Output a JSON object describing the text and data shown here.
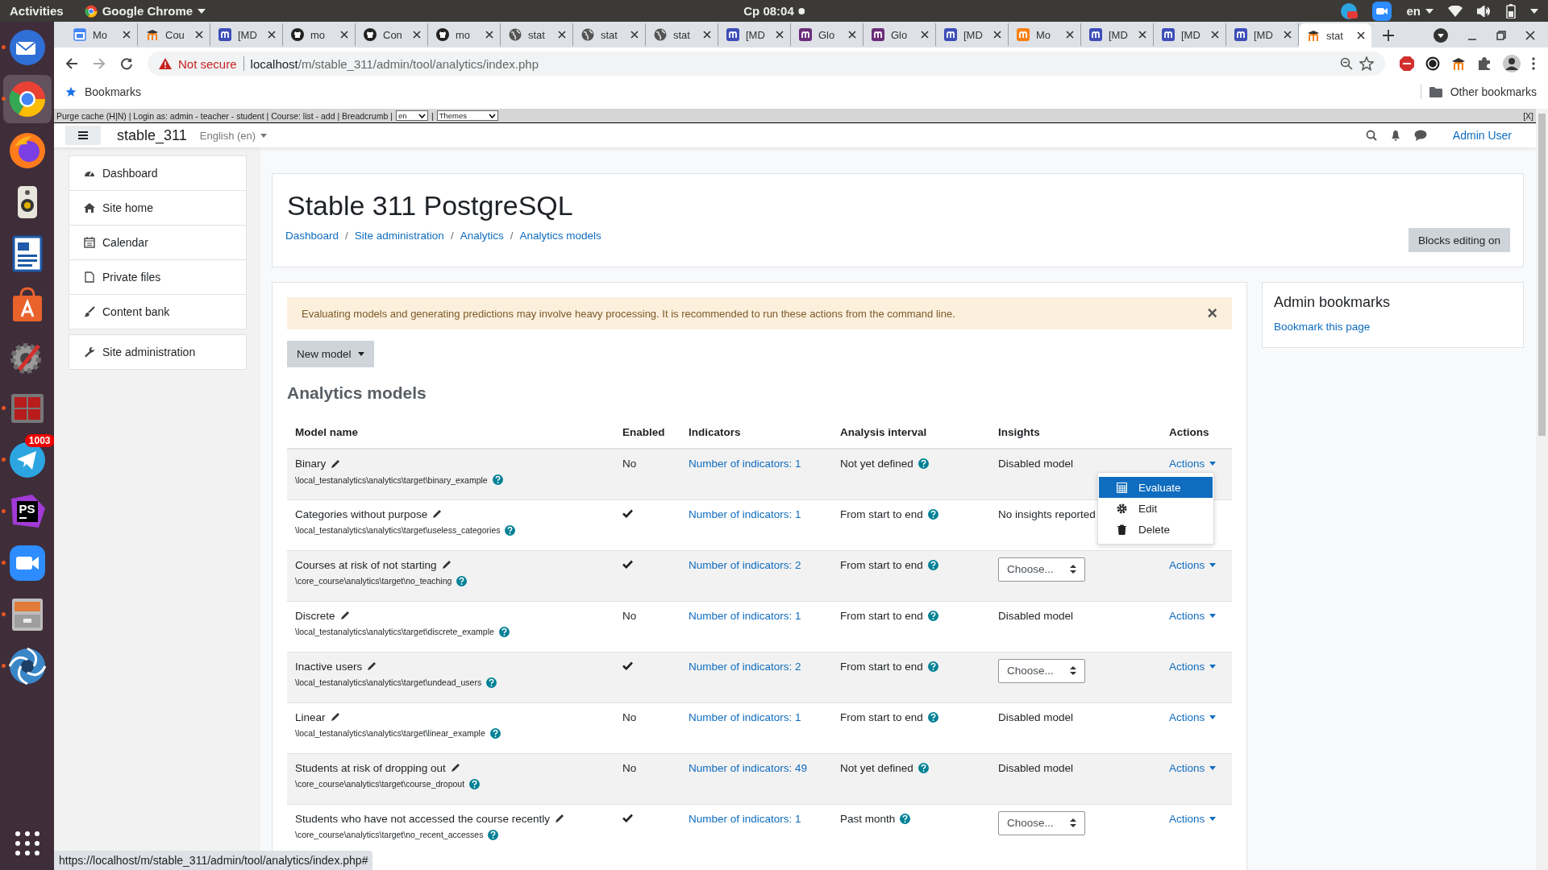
{
  "system_bar": {
    "activities": "Activities",
    "app": "Google Chrome",
    "clock": "Cp 08:04",
    "language": "en"
  },
  "dock": [
    {
      "kind": "mail",
      "running": true,
      "selected": false
    },
    {
      "kind": "chrome",
      "running": true,
      "selected": true
    },
    {
      "kind": "firefox",
      "running": false,
      "selected": false
    },
    {
      "kind": "speaker",
      "running": false,
      "selected": false
    },
    {
      "kind": "writer",
      "running": false,
      "selected": false
    },
    {
      "kind": "store",
      "running": false,
      "selected": false
    },
    {
      "kind": "settings",
      "running": false,
      "selected": false
    },
    {
      "kind": "terminal",
      "running": true,
      "selected": false
    },
    {
      "kind": "telegram",
      "running": true,
      "selected": false,
      "badge": "1003"
    },
    {
      "kind": "phpstorm",
      "running": true,
      "selected": false,
      "label": "PS"
    },
    {
      "kind": "zoom",
      "running": true,
      "selected": false
    },
    {
      "kind": "files",
      "running": true,
      "selected": false
    },
    {
      "kind": "shutter",
      "running": true,
      "selected": false
    }
  ],
  "tabs": [
    {
      "title": "Mo",
      "kind": "calendar",
      "selected": false
    },
    {
      "title": "Cou",
      "kind": "moodle",
      "selected": false
    },
    {
      "title": "[MD",
      "kind": "tracker",
      "selected": false
    },
    {
      "title": "mo",
      "kind": "github",
      "selected": false
    },
    {
      "title": "Con",
      "kind": "github",
      "selected": false
    },
    {
      "title": "mo",
      "kind": "github",
      "selected": false
    },
    {
      "title": "stat",
      "kind": "globe",
      "selected": false
    },
    {
      "title": "stat",
      "kind": "globe",
      "selected": false
    },
    {
      "title": "stat",
      "kind": "globe",
      "selected": false
    },
    {
      "title": "[MD",
      "kind": "tracker",
      "selected": false
    },
    {
      "title": "Glo",
      "kind": "glossary",
      "selected": false
    },
    {
      "title": "Glo",
      "kind": "glossary",
      "selected": false
    },
    {
      "title": "[MD",
      "kind": "tracker",
      "selected": false
    },
    {
      "title": "Mo",
      "kind": "orange",
      "selected": false
    },
    {
      "title": "[MD",
      "kind": "tracker",
      "selected": false
    },
    {
      "title": "[MD",
      "kind": "tracker",
      "selected": false
    },
    {
      "title": "[MD",
      "kind": "tracker",
      "selected": false
    },
    {
      "title": "stat",
      "kind": "moodle",
      "selected": true
    }
  ],
  "address": {
    "warning": "Not secure",
    "host": "localhost",
    "path": "/m/stable_311/admin/tool/analytics/index.php"
  },
  "bookmarks": {
    "label": "Bookmarks",
    "other": "Other bookmarks"
  },
  "dev_bar": {
    "text": "Purge cache (H|N) | Login as: admin - teacher - student | Course: list - add | Breadcrumb |",
    "language": "en",
    "separator": "|",
    "theme": "Themes",
    "close": "[X]"
  },
  "moodle_nav": {
    "site": "stable_311",
    "language": "English (en)",
    "user": "Admin User"
  },
  "sidebar": [
    [
      {
        "label": "Dashboard",
        "kind": "dashboard"
      },
      {
        "label": "Site home",
        "kind": "home"
      },
      {
        "label": "Calendar",
        "kind": "calendar"
      },
      {
        "label": "Private files",
        "kind": "file"
      },
      {
        "label": "Content bank",
        "kind": "brush"
      }
    ],
    [
      {
        "label": "Site administration",
        "kind": "wrench"
      }
    ]
  ],
  "header": {
    "title": "Stable 311 PostgreSQL",
    "breadcrumb": [
      "Dashboard",
      "Site administration",
      "Analytics",
      "Analytics models"
    ],
    "separator": "/",
    "button": "Blocks editing on"
  },
  "alert": {
    "text": "Evaluating models and generating predictions may involve heavy processing. It is recommended to run these actions from the command line.",
    "close": "×"
  },
  "new_model": "New model",
  "heading": "Analytics models",
  "table": {
    "columns": [
      "Model name",
      "Enabled",
      "Indicators",
      "Analysis interval",
      "Insights",
      "Actions"
    ],
    "rows": [
      {
        "name": "Binary",
        "target": "\\local_testanalytics\\analytics\\target\\binary_example",
        "enabled": false,
        "enabled_text": "No",
        "indicators": "Number of indicators: 1",
        "interval": "Not yet defined",
        "insights": {
          "kind": "text",
          "text": "Disabled model"
        },
        "actions": "Actions"
      },
      {
        "name": "Categories without purpose",
        "target": "\\local_testanalytics\\analytics\\target\\useless_categories",
        "enabled": true,
        "indicators": "Number of indicators: 1",
        "interval": "From start to end",
        "insights": {
          "kind": "text",
          "text": "No insights reported"
        }
      },
      {
        "name": "Courses at risk of not starting",
        "target": "\\core_course\\analytics\\target\\no_teaching",
        "enabled": true,
        "indicators": "Number of indicators: 2",
        "interval": "From start to end",
        "insights": {
          "kind": "select",
          "text": "Choose..."
        },
        "actions": "Actions"
      },
      {
        "name": "Discrete",
        "target": "\\local_testanalytics\\analytics\\target\\discrete_example",
        "enabled": false,
        "enabled_text": "No",
        "indicators": "Number of indicators: 1",
        "interval": "From start to end",
        "insights": {
          "kind": "text",
          "text": "Disabled model"
        },
        "actions": "Actions"
      },
      {
        "name": "Inactive users",
        "target": "\\local_testanalytics\\analytics\\target\\undead_users",
        "enabled": true,
        "indicators": "Number of indicators: 2",
        "interval": "From start to end",
        "insights": {
          "kind": "select",
          "text": "Choose..."
        },
        "actions": "Actions"
      },
      {
        "name": "Linear",
        "target": "\\local_testanalytics\\analytics\\target\\linear_example",
        "enabled": false,
        "enabled_text": "No",
        "indicators": "Number of indicators: 1",
        "interval": "From start to end",
        "insights": {
          "kind": "text",
          "text": "Disabled model"
        },
        "actions": "Actions"
      },
      {
        "name": "Students at risk of dropping out",
        "target": "\\core_course\\analytics\\target\\course_dropout",
        "enabled": false,
        "enabled_text": "No",
        "indicators": "Number of indicators: 49",
        "interval": "Not yet defined",
        "insights": {
          "kind": "text",
          "text": "Disabled model"
        },
        "actions": "Actions"
      },
      {
        "name": "Students who have not accessed the course recently",
        "target": "\\core_course\\analytics\\target\\no_recent_accesses",
        "enabled": true,
        "indicators": "Number of indicators: 1",
        "interval": "Past month",
        "insights": {
          "kind": "select",
          "text": "Choose..."
        },
        "actions": "Actions"
      }
    ]
  },
  "actions_menu": [
    {
      "label": "Evaluate",
      "kind": "calculator",
      "selected": true
    },
    {
      "label": "Edit",
      "kind": "gear",
      "selected": false
    },
    {
      "label": "Delete",
      "kind": "trash",
      "selected": false
    }
  ],
  "admin_bookmarks": {
    "title": "Admin bookmarks",
    "link": "Bookmark this page"
  },
  "status_url": "https://localhost/m/stable_311/admin/tool/analytics/index.php#"
}
